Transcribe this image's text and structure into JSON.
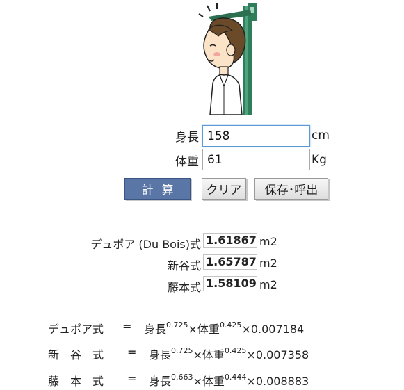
{
  "form": {
    "height_label": "身長",
    "height_value": "158",
    "height_unit": "cm",
    "weight_label": "体重",
    "weight_value": "61",
    "weight_unit": "Kg"
  },
  "buttons": {
    "calc_label": "計算",
    "clear_label": "クリア",
    "save_label": "保存･呼出"
  },
  "results": [
    {
      "label": "デュポア (Du Bois)式",
      "value": "1.61867",
      "unit": "m2"
    },
    {
      "label": "新谷式",
      "value": "1.65787",
      "unit": "m2"
    },
    {
      "label": "藤本式",
      "value": "1.58109",
      "unit": "m2"
    }
  ],
  "formulas": [
    {
      "name": "デュポア式",
      "eq": "=",
      "h": "身長",
      "h_exp": "0.725",
      "times1": "×",
      "w": "体重",
      "w_exp": "0.425",
      "times2": "×",
      "coef": "0.007184"
    },
    {
      "name": "新　谷　式",
      "eq": "=",
      "h": "身長",
      "h_exp": "0.725",
      "times1": "×",
      "w": "体重",
      "w_exp": "0.425",
      "times2": "×",
      "coef": "0.007358"
    },
    {
      "name": "藤　本　式",
      "eq": "=",
      "h": "身長",
      "h_exp": "0.663",
      "times1": "×",
      "w": "体重",
      "w_exp": "0.444",
      "times2": "×",
      "coef": "0.008883"
    }
  ],
  "colors": {
    "calc_button_bg": "#5a76a6",
    "focus_border": "#5b9bd5",
    "stadiometer_green": "#2e7d5b"
  },
  "icons": {
    "illustration": "person-measuring-height-illustration"
  }
}
